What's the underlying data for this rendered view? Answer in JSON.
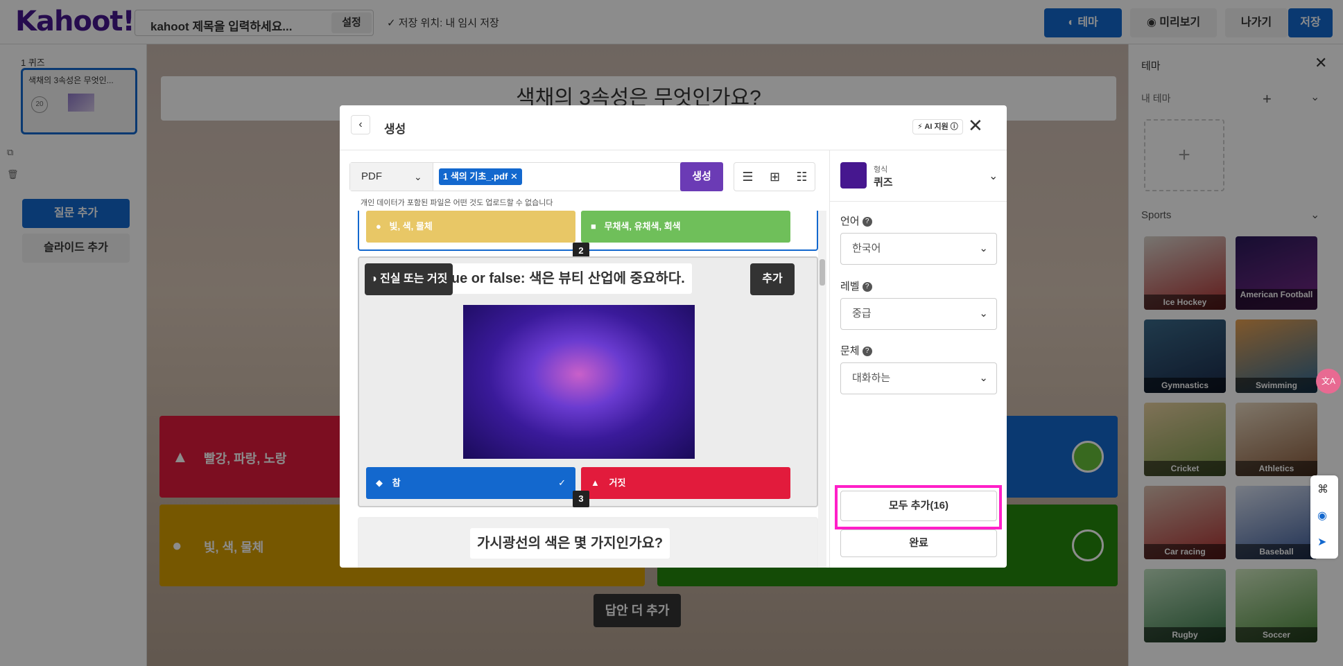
{
  "app": {
    "logo": "Kahoot!+",
    "title_placeholder": "kahoot 제목을 입력하세요...",
    "settings_label": "설정",
    "save_location": "저장 위치: 내 임시 저장",
    "theme_button": "테마",
    "preview_button": "미리보기",
    "exit_button": "나가기",
    "save_button": "저장"
  },
  "sidebar": {
    "slide_label": "1  퀴즈",
    "slide_title": "색채의 3속성은 무엇인...",
    "slide_timer": "20",
    "add_question": "질문 추가",
    "add_slide": "슬라이드 추가"
  },
  "canvas": {
    "question": "색채의 3속성은 무엇인가요?",
    "answers": [
      "빨강, 파랑, 노랑",
      "",
      "빛, 색, 물체",
      ""
    ],
    "more_answers": "답안 더 추가"
  },
  "right_panel": {
    "title": "테마",
    "my_theme": "내 테마",
    "sports_label": "Sports",
    "themes": [
      "Ice Hockey",
      "American Football",
      "Gymnastics",
      "Swimming",
      "Cricket",
      "Athletics",
      "Car racing",
      "Baseball",
      "Rugby",
      "Soccer"
    ]
  },
  "modal": {
    "title": "생성",
    "ai_badge": "AI 지원",
    "source_type": "PDF",
    "file_chip": "1 색의 기초_.pdf",
    "generate_button": "생성",
    "privacy_note": "개인 데이터가 포함된 파일은 어떤 것도 업로드할 수 없습니다",
    "card1": {
      "option_a": "빛, 색, 물체",
      "option_b": "무채색, 유채색, 회색",
      "number": "2"
    },
    "card2": {
      "type_label": "진실 또는 거짓",
      "title": "True or false: 색은 뷰티 산업에 중요하다.",
      "add_button": "추가",
      "true_label": "참",
      "false_label": "거짓",
      "number": "3"
    },
    "card3": {
      "title": "가시광선의 색은 몇 가지인가요?"
    },
    "format_small": "형식",
    "format_value": "퀴즈",
    "language_label": "언어",
    "language_value": "한국어",
    "level_label": "레벨",
    "level_value": "중급",
    "style_label": "문체",
    "style_value": "대화하는",
    "add_all": "모두 추가(16)",
    "done": "완료"
  },
  "colors": {
    "brand_purple": "#46178f",
    "blue": "#1368ce",
    "red": "#e21b3c",
    "yellow": "#d89e00",
    "green": "#26890c",
    "highlight_magenta": "#ff1fc8"
  }
}
